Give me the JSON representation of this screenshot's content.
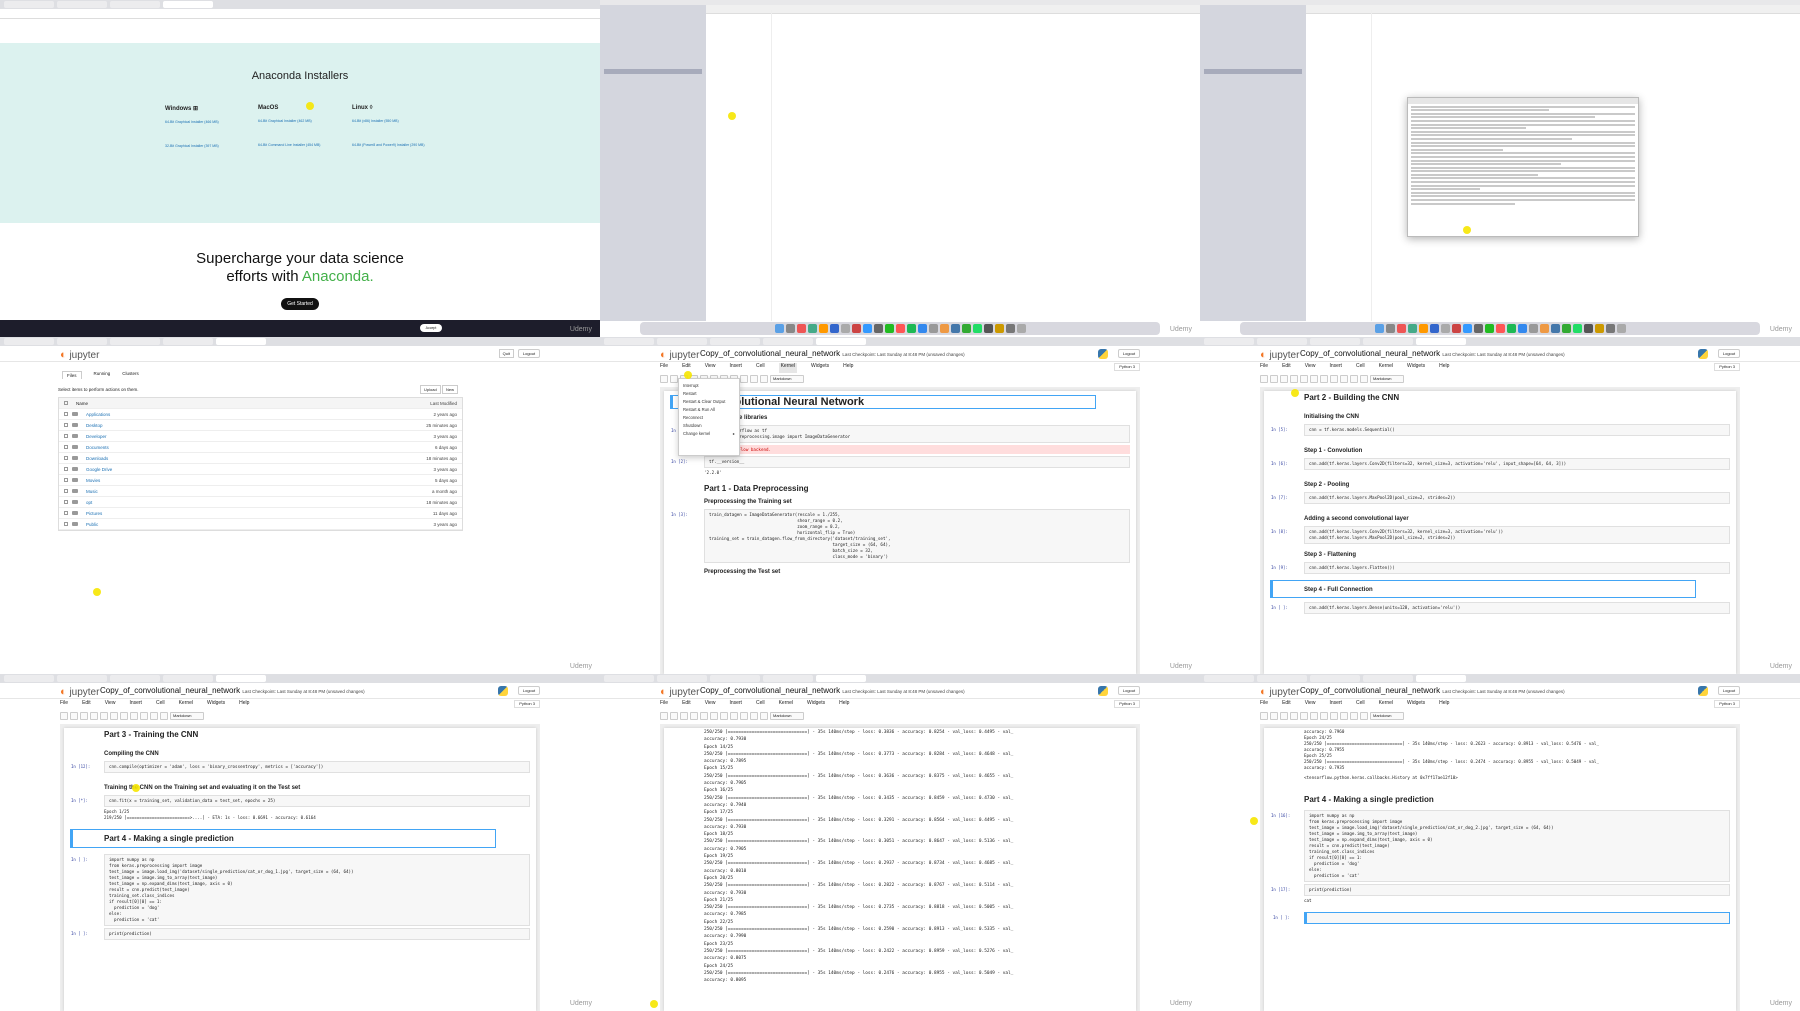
{
  "watermark": "Udemy",
  "anaconda": {
    "title": "Anaconda Installers",
    "cols": [
      {
        "name": "Windows ⊞",
        "links": [
          "64-Bit Graphical Installer (466 MB)",
          "32-Bit Graphical Installer (397 MB)"
        ]
      },
      {
        "name": "MacOS ",
        "links": [
          "64-Bit Graphical Installer (462 MB)",
          "64-Bit Command Line Installer (454 MB)"
        ]
      },
      {
        "name": "Linux ◊",
        "links": [
          "64-Bit (x86) Installer (550 MB)",
          "64-Bit (Power8 and Power9) Installer (290 MB)"
        ]
      }
    ],
    "hero_a": "Supercharge your data science",
    "hero_b": "efforts with ",
    "hero_brand": "Anaconda.",
    "hero_btn": "Get Started",
    "cookie_btn": "Accept"
  },
  "jupyter": {
    "logo": "jupyter",
    "nb_title": "Copy_of_convolutional_neural_network",
    "nb_meta": "Last Checkpoint: Last Sunday at 8:48 PM  (unsaved changes)",
    "logout": "Logout",
    "menu": [
      "File",
      "Edit",
      "View",
      "Insert",
      "Cell",
      "Kernel",
      "Widgets",
      "Help"
    ],
    "kernel": "Python 3",
    "cell_type": "Markdown"
  },
  "filebrowser": {
    "tabs": [
      "Files",
      "Running",
      "Clusters"
    ],
    "hint": "Select items to perform actions on them.",
    "quit": "Quit",
    "upload": "Upload",
    "new": "New",
    "name_header": "Name",
    "modified_header": "Last Modified",
    "rows": [
      {
        "name": "Applications",
        "date": "2 years ago"
      },
      {
        "name": "Desktop",
        "date": "25 minutes ago"
      },
      {
        "name": "Developer",
        "date": "3 years ago"
      },
      {
        "name": "Documents",
        "date": "6 days ago"
      },
      {
        "name": "Downloads",
        "date": "18 minutes ago"
      },
      {
        "name": "Google Drive",
        "date": "3 years ago"
      },
      {
        "name": "Movies",
        "date": "5 days ago"
      },
      {
        "name": "Music",
        "date": "a month ago"
      },
      {
        "name": "opt",
        "date": "18 minutes ago"
      },
      {
        "name": "Pictures",
        "date": "11 days ago"
      },
      {
        "name": "Public",
        "date": "3 years ago"
      }
    ]
  },
  "nb5": {
    "title": "Convolutional Neural Network",
    "imp": "Importing the libraries",
    "code1": "import tensorflow as tf\nfrom keras.preprocessing.image import ImageDataGenerator",
    "err": "Using TensorFlow backend.",
    "code2": "tf.__version__",
    "out2": "'2.2.0'",
    "part1": "Part 1 - Data Preprocessing",
    "prep_train": "Preprocessing the Training set",
    "code3": "train_datagen = ImageDataGenerator(rescale = 1./255,\n                                   shear_range = 0.2,\n                                   zoom_range = 0.2,\n                                   horizontal_flip = True)\ntraining_set = train_datagen.flow_from_directory('dataset/training_set',\n                                                 target_size = (64, 64),\n                                                 batch_size = 32,\n                                                 class_mode = 'binary')",
    "prep_test": "Preprocessing the Test set",
    "menu": [
      "Interrupt",
      "Restart",
      "Restart & Clear Output",
      "Restart & Run All",
      "Reconnect",
      "Shutdown",
      "Change kernel"
    ]
  },
  "nb6": {
    "part2": "Part 2 - Building the CNN",
    "init": "Initialising the CNN",
    "c_init": "cnn = tf.keras.models.Sequential()",
    "s1": "Step 1 - Convolution",
    "c1": "cnn.add(tf.keras.layers.Conv2D(filters=32, kernel_size=3, activation='relu', input_shape=[64, 64, 3]))",
    "s2": "Step 2 - Pooling",
    "c2": "cnn.add(tf.keras.layers.MaxPool2D(pool_size=2, strides=2))",
    "s2b": "Adding a second convolutional layer",
    "c2b": "cnn.add(tf.keras.layers.Conv2D(filters=32, kernel_size=3, activation='relu'))\ncnn.add(tf.keras.layers.MaxPool2D(pool_size=2, strides=2))",
    "s3": "Step 3 - Flattening",
    "c3": "cnn.add(tf.keras.layers.Flatten())",
    "s4": "Step 4 - Full Connection",
    "c4": "cnn.add(tf.keras.layers.Dense(units=128, activation='relu'))"
  },
  "nb7": {
    "part3": "Part 3 - Training the CNN",
    "compile": "Compiling the CNN",
    "c_compile": "cnn.compile(optimizer = 'adam', loss = 'binary_crossentropy', metrics = ['accuracy'])",
    "train": "Training the CNN on the Training set and evaluating it on the Test set",
    "c_fit": "cnn.fit(x = training_set, validation_data = test_set, epochs = 25)",
    "o_fit": "Epoch 1/25\n219/250 [=========================>....] - ETA: 1s - loss: 0.6691 - accuracy: 0.6164",
    "part4": "Part 4 - Making a single prediction",
    "c_pred": "import numpy as np\nfrom keras.preprocessing import image\ntest_image = image.load_img('dataset/single_prediction/cat_or_dog_1.jpg', target_size = (64, 64))\ntest_image = image.img_to_array(test_image)\ntest_image = np.expand_dims(test_image, axis = 0)\nresult = cnn.predict(test_image)\ntraining_set.class_indices\nif result[0][0] == 1:\n  prediction = 'dog'\nelse:\n  prediction = 'cat'",
    "c_print": "print(prediction)"
  },
  "nb8": {
    "log": "250/250 [==============================] - 35s 140ms/step - loss: 0.3836 - accuracy: 0.8254 - val_loss: 0.4495 - val_\naccuracy: 0.7930\nEpoch 14/25\n250/250 [==============================] - 35s 140ms/step - loss: 0.3773 - accuracy: 0.8284 - val_loss: 0.4648 - val_\naccuracy: 0.7895\nEpoch 15/25\n250/250 [==============================] - 35s 140ms/step - loss: 0.3636 - accuracy: 0.8375 - val_loss: 0.4655 - val_\naccuracy: 0.7905\nEpoch 16/25\n250/250 [==============================] - 35s 140ms/step - loss: 0.3435 - accuracy: 0.8459 - val_loss: 0.4730 - val_\naccuracy: 0.7940\nEpoch 17/25\n250/250 [==============================] - 35s 140ms/step - loss: 0.3291 - accuracy: 0.8564 - val_loss: 0.4495 - val_\naccuracy: 0.7930\nEpoch 18/25\n250/250 [==============================] - 35s 140ms/step - loss: 0.3051 - accuracy: 0.8647 - val_loss: 0.5136 - val_\naccuracy: 0.7905\nEpoch 19/25\n250/250 [==============================] - 35s 140ms/step - loss: 0.2937 - accuracy: 0.8734 - val_loss: 0.4685 - val_\naccuracy: 0.8010\nEpoch 20/25\n250/250 [==============================] - 35s 140ms/step - loss: 0.2822 - accuracy: 0.8767 - val_loss: 0.5114 - val_\naccuracy: 0.7930\nEpoch 21/25\n250/250 [==============================] - 35s 140ms/step - loss: 0.2735 - accuracy: 0.8818 - val_loss: 0.5005 - val_\naccuracy: 0.7985\nEpoch 22/25\n250/250 [==============================] - 35s 140ms/step - loss: 0.2590 - accuracy: 0.8913 - val_loss: 0.5335 - val_\naccuracy: 0.7990\nEpoch 23/25\n250/250 [==============================] - 35s 140ms/step - loss: 0.2422 - accuracy: 0.8959 - val_loss: 0.5276 - val_\naccuracy: 0.8075\nEpoch 24/25\n250/250 [==============================] - 35s 140ms/step - loss: 0.2476 - accuracy: 0.8955 - val_loss: 0.5049 - val_\naccuracy: 0.8095"
  },
  "nb9": {
    "log": "accuracy: 0.7960\nEpoch 24/25\n250/250 [==============================] - 35s 140ms/step - loss: 0.2623 - accuracy: 0.8913 - val_loss: 0.5476 - val_\naccuracy: 0.7955\nEpoch 25/25\n250/250 [==============================] - 35s 140ms/step - loss: 0.2474 - accuracy: 0.8955 - val_loss: 0.5049 - val_\naccuracy: 0.7935",
    "out": "<tensorflow.python.keras.callbacks.History at 0x7ff17ae12f10>",
    "part4": "Part 4 - Making a single prediction",
    "c_pred": "import numpy as np\nfrom keras.preprocessing import image\ntest_image = image.load_img('dataset/single_prediction/cat_or_dog_2.jpg', target_size = (64, 64))\ntest_image = image.img_to_array(test_image)\ntest_image = np.expand_dims(test_image, axis = 0)\nresult = cnn.predict(test_image)\ntraining_set.class_indices\nif result[0][0] == 1:\n  prediction = 'dog'\nelse:\n  prediction = 'cat'",
    "c_print": "print(prediction)",
    "result": "cat"
  }
}
